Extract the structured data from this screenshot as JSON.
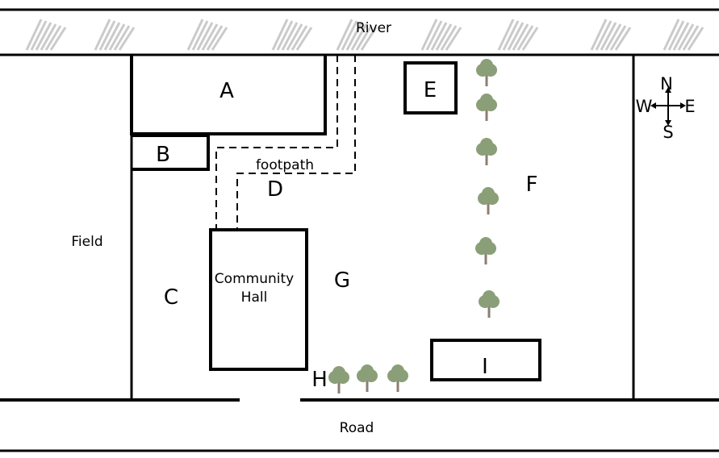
{
  "labels": {
    "river": "River",
    "road": "Road",
    "field": "Field",
    "footpath": "footpath",
    "hall_line1": "Community",
    "hall_line2": "Hall",
    "a": "A",
    "b": "B",
    "c": "C",
    "d": "D",
    "e": "E",
    "f": "F",
    "g": "G",
    "h": "H",
    "i": "I"
  },
  "compass": {
    "n": "N",
    "s": "S",
    "e": "E",
    "w": "W"
  },
  "colors": {
    "tree_foliage": "#8a9f78",
    "tree_trunk": "#8b7e74",
    "river_reeds": "#b5b5b5"
  }
}
